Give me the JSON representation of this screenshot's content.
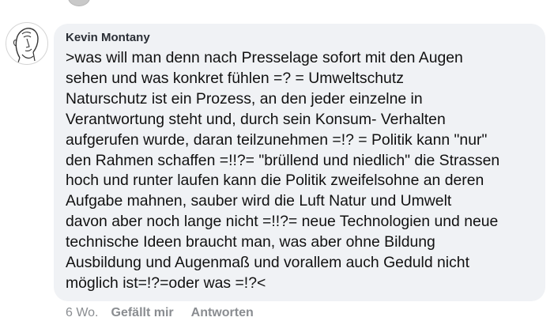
{
  "comment": {
    "author": "Kevin Montany",
    "text": ">was will man denn nach Presselage sofort  mit den Augen\nsehen und was konkret fühlen   =? = Umweltschutz\nNaturschutz ist ein Prozess, an den jeder einzelne in\nVerantwortung steht und, durch sein Konsum- Verhalten\naufgerufen wurde, daran teilzunehmen =!? = Politik kann \"nur\"\nden Rahmen schaffen =!!?= \"brüllend und niedlich\" die Strassen\nhoch und runter laufen kann die Politik zweifelsohne an deren\nAufgabe mahnen,  sauber wird die Luft Natur und Umwelt\ndavon aber noch lange nicht =!!?= neue Technologien und  neue\ntechnische  Ideen braucht man, was aber ohne Bildung\nAusbildung und Augenmaß und vorallem auch Geduld nicht\nmöglich ist=!?=oder was =!?<",
    "time": "6 Wo.",
    "like_label": "Gefällt mir",
    "reply_label": "Antworten"
  },
  "colors": {
    "bubble_bg": "#f0f2f5",
    "text": "#111111",
    "meta": "#8a8d91"
  },
  "icons": {
    "avatar": "sketch-profile-avatar"
  }
}
